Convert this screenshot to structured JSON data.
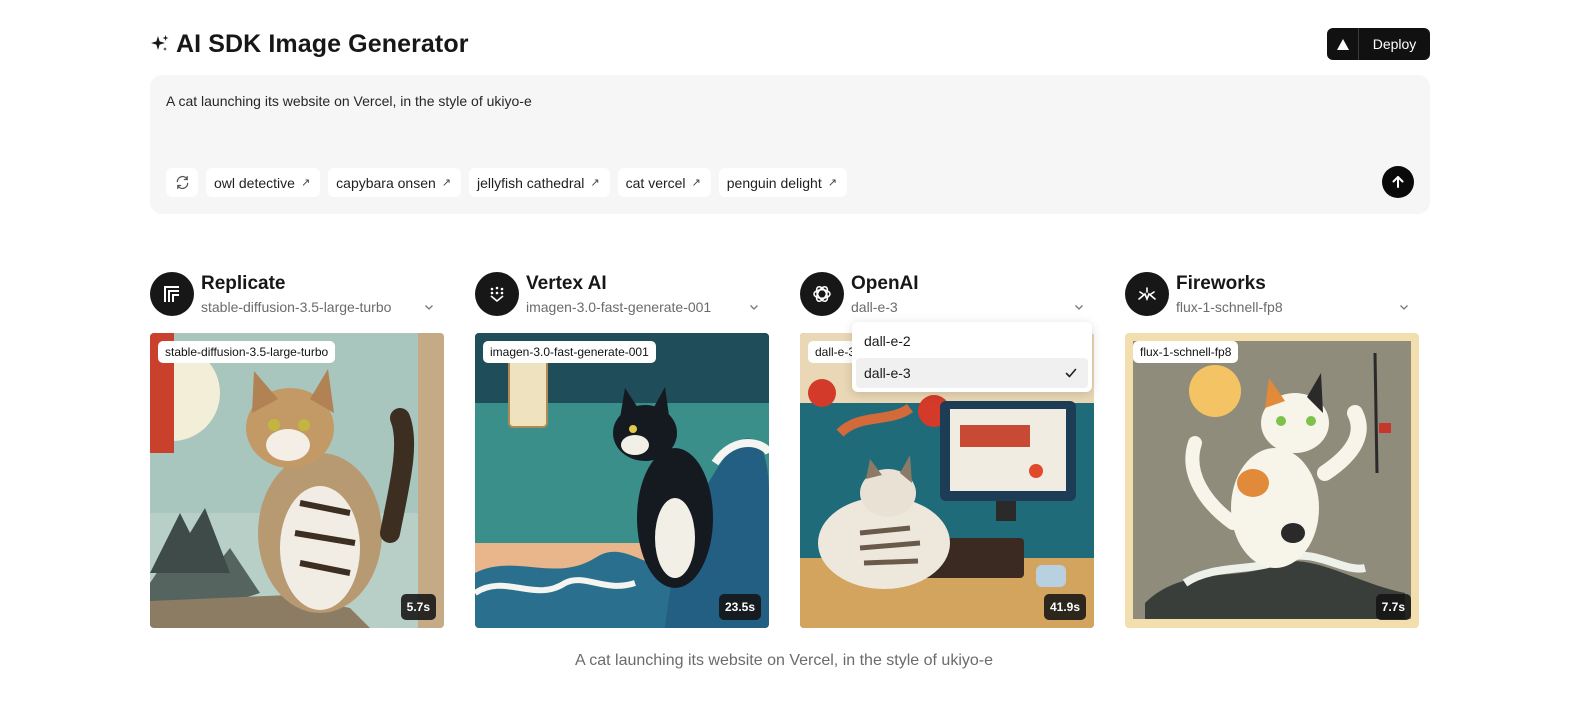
{
  "app": {
    "title": "AI SDK Image Generator",
    "deploy_label": "Deploy"
  },
  "prompt": {
    "text": "A cat launching its website on Vercel, in the style of ukiyo-e",
    "suggestions": [
      {
        "label": "owl detective"
      },
      {
        "label": "capybara onsen"
      },
      {
        "label": "jellyfish cathedral"
      },
      {
        "label": "cat vercel"
      },
      {
        "label": "penguin delight"
      }
    ]
  },
  "providers": [
    {
      "name": "Replicate",
      "model": "stable-diffusion-3.5-large-turbo",
      "badge": "stable-diffusion-3.5-large-turbo",
      "time": "5.7s",
      "logo_icon": "replicate-icon"
    },
    {
      "name": "Vertex AI",
      "model": "imagen-3.0-fast-generate-001",
      "badge": "imagen-3.0-fast-generate-001",
      "time": "23.5s",
      "logo_icon": "vertex-ai-icon"
    },
    {
      "name": "OpenAI",
      "model": "dall-e-3",
      "badge": "dall-e-3",
      "time": "41.9s",
      "logo_icon": "openai-icon"
    },
    {
      "name": "Fireworks",
      "model": "flux-1-schnell-fp8",
      "badge": "flux-1-schnell-fp8",
      "time": "7.7s",
      "logo_icon": "fireworks-icon"
    }
  ],
  "dropdown": {
    "options": [
      "dall-e-2",
      "dall-e-3"
    ],
    "selected": "dall-e-3"
  },
  "caption": "A cat launching its website on Vercel, in the style of ukiyo-e",
  "colors": {
    "accent": "#0a0a0a",
    "prompt_bg": "#f6f6f6",
    "muted_text": "#6b6b6b"
  }
}
